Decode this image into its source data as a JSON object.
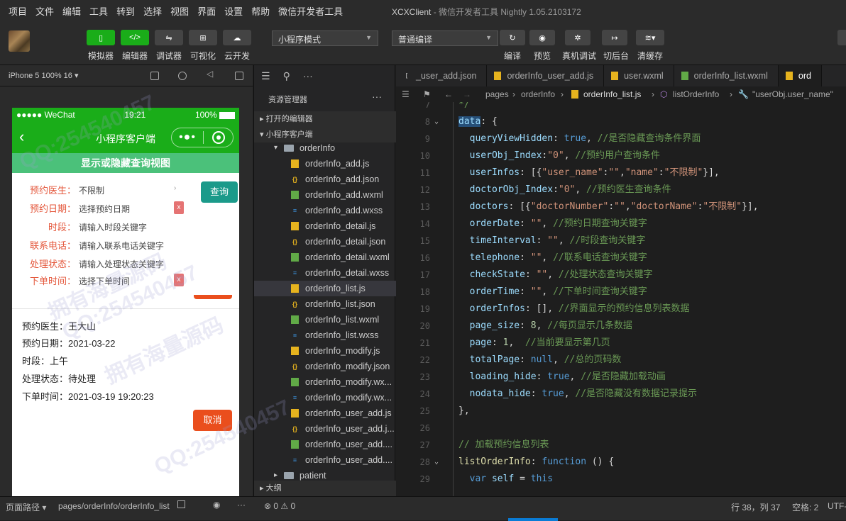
{
  "menu": [
    "项目",
    "文件",
    "编辑",
    "工具",
    "转到",
    "选择",
    "视图",
    "界面",
    "设置",
    "帮助",
    "微信开发者工具"
  ],
  "window_title": {
    "app": "XCXClient",
    "rest": " - 微信开发者工具 Nightly 1.05.2103172"
  },
  "toolbar": {
    "left_buttons": [
      "模拟器",
      "编辑器",
      "调试器",
      "可视化",
      "云开发"
    ],
    "mode_select": "小程序模式",
    "compile_select": "普通编译",
    "right_buttons": [
      "编译",
      "预览",
      "真机调试",
      "切后台",
      "清缓存"
    ]
  },
  "simulator": {
    "device": "iPhone 5 100% 16 ▾",
    "status": {
      "carrier": "●●●●● WeChat",
      "time": "19:21",
      "battery": "100%"
    },
    "nav_title": "小程序客户端",
    "toggle_label": "显示或隐藏查询视图",
    "form": [
      {
        "label": "预约医生：",
        "value": "不限制"
      },
      {
        "label": "预约日期：",
        "value": "选择预约日期"
      },
      {
        "label": "时段：",
        "value": "请输入时段关键字"
      },
      {
        "label": "联系电话：",
        "value": "请输入联系电话关键字"
      },
      {
        "label": "处理状态：",
        "value": "请输入处理状态关键字"
      },
      {
        "label": "下单时间：",
        "value": "选择下单时间"
      }
    ],
    "query_button": "查询",
    "clear_x": "x",
    "record": [
      "预约医生：王大山",
      "预约日期：2021-03-22",
      "时段：上午",
      "处理状态：待处理",
      "下单时间：2021-03-19 19:20:23"
    ],
    "cancel_button": "取消"
  },
  "explorer": {
    "title": "资源管理器",
    "open_editors": "打开的编辑器",
    "project": "小程序客户端",
    "folder": "orderInfo",
    "files": [
      {
        "name": "orderInfo_add.js",
        "type": "js"
      },
      {
        "name": "orderInfo_add.json",
        "type": "json"
      },
      {
        "name": "orderInfo_add.wxml",
        "type": "wxml"
      },
      {
        "name": "orderInfo_add.wxss",
        "type": "wxss"
      },
      {
        "name": "orderInfo_detail.js",
        "type": "js"
      },
      {
        "name": "orderInfo_detail.json",
        "type": "json"
      },
      {
        "name": "orderInfo_detail.wxml",
        "type": "wxml"
      },
      {
        "name": "orderInfo_detail.wxss",
        "type": "wxss"
      },
      {
        "name": "orderInfo_list.js",
        "type": "js",
        "active": true
      },
      {
        "name": "orderInfo_list.json",
        "type": "json"
      },
      {
        "name": "orderInfo_list.wxml",
        "type": "wxml"
      },
      {
        "name": "orderInfo_list.wxss",
        "type": "wxss"
      },
      {
        "name": "orderInfo_modify.js",
        "type": "js"
      },
      {
        "name": "orderInfo_modify.json",
        "type": "json"
      },
      {
        "name": "orderInfo_modify.wx...",
        "type": "wxml"
      },
      {
        "name": "orderInfo_modify.wx...",
        "type": "wxss"
      },
      {
        "name": "orderInfo_user_add.js",
        "type": "js"
      },
      {
        "name": "orderInfo_user_add.j...",
        "type": "json"
      },
      {
        "name": "orderInfo_user_add....",
        "type": "wxml"
      },
      {
        "name": "orderInfo_user_add....",
        "type": "wxss"
      }
    ],
    "next_folder": "patient",
    "outline": "大纲"
  },
  "editor": {
    "tabs": [
      {
        "name": "_user_add.json",
        "type": "json"
      },
      {
        "name": "orderInfo_user_add.js",
        "type": "js"
      },
      {
        "name": "user.wxml",
        "type": "js"
      },
      {
        "name": "orderInfo_list.wxml",
        "type": "wxml"
      },
      {
        "name": "ord",
        "type": "js",
        "active": true
      }
    ],
    "breadcrumb": [
      "pages",
      "orderInfo",
      "orderInfo_list.js",
      "listOrderInfo",
      "\"userObj.user_name\""
    ],
    "lines": [
      {
        "n": "7",
        "html": "<span class='c'>*/</span>"
      },
      {
        "n": "8",
        "html": "<span class='k' style='background:#264f78'>data</span>: {",
        "fold": true
      },
      {
        "n": "9",
        "html": "  <span class='k'>queryViewHidden</span>: <span class='kw'>true</span>, <span class='c'>//是否隐藏查询条件界面</span>"
      },
      {
        "n": "10",
        "html": "  <span class='k'>userObj_Index</span>:<span class='s'>\"0\"</span>, <span class='c'>//预约用户查询条件</span>"
      },
      {
        "n": "11",
        "html": "  <span class='k'>userInfos</span>: [{<span class='s'>\"user_name\"</span>:<span class='s'>\"\"</span>,<span class='s'>\"name\"</span>:<span class='s'>\"不限制\"</span>}],"
      },
      {
        "n": "12",
        "html": "  <span class='k'>doctorObj_Index</span>:<span class='s'>\"0\"</span>, <span class='c'>//预约医生查询条件</span>"
      },
      {
        "n": "13",
        "html": "  <span class='k'>doctors</span>: [{<span class='s'>\"doctorNumber\"</span>:<span class='s'>\"\"</span>,<span class='s'>\"doctorName\"</span>:<span class='s'>\"不限制\"</span>}],"
      },
      {
        "n": "14",
        "html": "  <span class='k'>orderDate</span>: <span class='s'>\"\"</span>, <span class='c'>//预约日期查询关键字</span>"
      },
      {
        "n": "15",
        "html": "  <span class='k'>timeInterval</span>: <span class='s'>\"\"</span>, <span class='c'>//时段查询关键字</span>"
      },
      {
        "n": "16",
        "html": "  <span class='k'>telephone</span>: <span class='s'>\"\"</span>, <span class='c'>//联系电话查询关键字</span>"
      },
      {
        "n": "17",
        "html": "  <span class='k'>checkState</span>: <span class='s'>\"\"</span>, <span class='c'>//处理状态查询关键字</span>"
      },
      {
        "n": "18",
        "html": "  <span class='k'>orderTime</span>: <span class='s'>\"\"</span>, <span class='c'>//下单时间查询关键字</span>"
      },
      {
        "n": "19",
        "html": "  <span class='k'>orderInfos</span>: [], <span class='c'>//界面显示的预约信息列表数据</span>"
      },
      {
        "n": "20",
        "html": "  <span class='k'>page_size</span>: <span class='n'>8</span>, <span class='c'>//每页显示几条数据</span>"
      },
      {
        "n": "21",
        "html": "  <span class='k'>page</span>: <span class='n'>1</span>,  <span class='c'>//当前要显示第几页</span>"
      },
      {
        "n": "22",
        "html": "  <span class='k'>totalPage</span>: <span class='kw'>null</span>, <span class='c'>//总的页码数</span>"
      },
      {
        "n": "23",
        "html": "  <span class='k'>loading_hide</span>: <span class='kw'>true</span>, <span class='c'>//是否隐藏加载动画</span>"
      },
      {
        "n": "24",
        "html": "  <span class='k'>nodata_hide</span>: <span class='kw'>true</span>, <span class='c'>//是否隐藏没有数据记录提示</span>"
      },
      {
        "n": "25",
        "html": "},"
      },
      {
        "n": "26",
        "html": ""
      },
      {
        "n": "27",
        "html": "<span class='c'>// 加载预约信息列表</span>"
      },
      {
        "n": "28",
        "html": "<span class='fn'>listOrderInfo</span>: <span class='kw'>function</span> () {",
        "fold": true
      },
      {
        "n": "29",
        "html": "  <span class='kw'>var</span> <span class='k'>self</span> = <span class='kw'>this</span>"
      }
    ]
  },
  "statusbar": {
    "page_path_label": "页面路径 ▾",
    "page_path": "pages/orderInfo/orderInfo_list",
    "problems": "⊗ 0 ⚠ 0",
    "position": "行 38，列 37",
    "spaces": "空格: 2",
    "encoding": "UTF-"
  },
  "watermarks": [
    "QQ:254540457",
    "拥有海量源码",
    "QQ:254540457",
    "拥有海量源码",
    "QQ:254540457"
  ]
}
